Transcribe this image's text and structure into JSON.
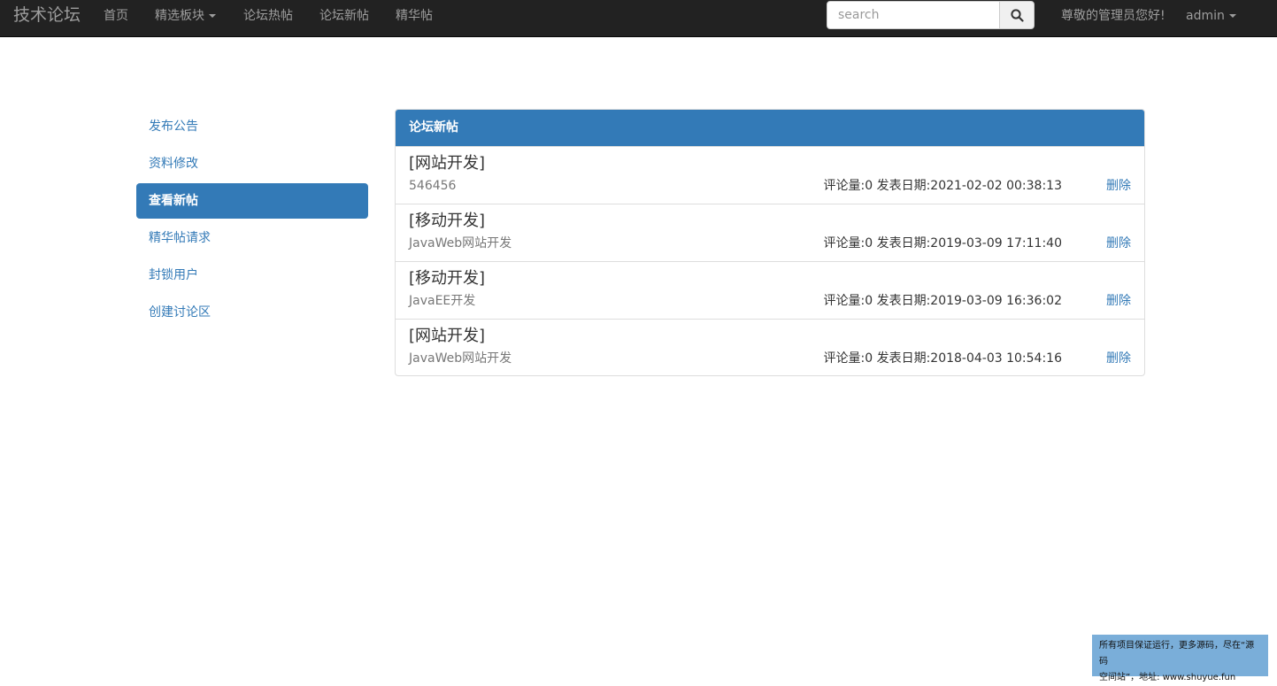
{
  "navbar": {
    "brand": "技术论坛",
    "items": [
      {
        "label": "首页"
      },
      {
        "label": "精选板块"
      },
      {
        "label": "论坛热帖"
      },
      {
        "label": "论坛新帖"
      },
      {
        "label": "精华帖"
      }
    ],
    "search_placeholder": "search",
    "search_value": "",
    "greeting": "尊敬的管理员您好!",
    "user": "admin"
  },
  "sidebar": {
    "items": [
      {
        "label": "发布公告"
      },
      {
        "label": "资料修改"
      },
      {
        "label": "查看新帖"
      },
      {
        "label": "精华帖请求"
      },
      {
        "label": "封锁用户"
      },
      {
        "label": "创建讨论区"
      }
    ],
    "active_label": "查看新帖"
  },
  "panel": {
    "title": "论坛新帖",
    "posts": [
      {
        "title": "[网站开发]",
        "summary": "546456",
        "meta": "评论量:0 发表日期:2021-02-02 00:38:13",
        "action": "删除"
      },
      {
        "title": "[移动开发]",
        "summary": "JavaWeb网站开发",
        "meta": "评论量:0 发表日期:2019-03-09 17:11:40",
        "action": "删除"
      },
      {
        "title": "[移动开发]",
        "summary": "JavaEE开发",
        "meta": "评论量:0 发表日期:2019-03-09 16:36:02",
        "action": "删除"
      },
      {
        "title": "[网站开发]",
        "summary": "JavaWeb网站开发",
        "meta": "评论量:0 发表日期:2018-04-03 10:54:16",
        "action": "删除"
      }
    ]
  },
  "note": {
    "line1": "所有项目保证运行，更多源码，尽在“源码",
    "line2": "空间站”，地址: www.shuyue.fun"
  },
  "colors": {
    "navbar_bg": "#222222",
    "accent": "#337ab7",
    "note_bg": "#7aaed9"
  },
  "icons": {
    "search": "search-icon",
    "dropdown": "caret-down-icon"
  }
}
